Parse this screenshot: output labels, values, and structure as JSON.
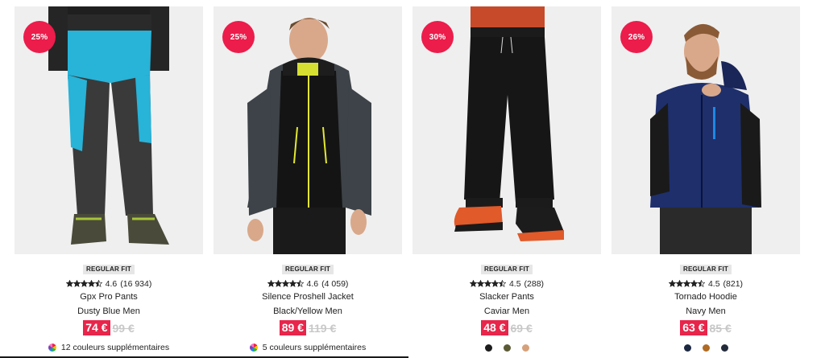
{
  "products": [
    {
      "discount": "25%",
      "fit": "REGULAR FIT",
      "rating": "4.6",
      "reviews": "(16 934)",
      "stars": 4.5,
      "name": "Gpx Pro Pants",
      "color": "Dusty Blue Men",
      "price": "74 €",
      "old_price": "99 €",
      "extra_colors": "12 couleurs supplémentaires",
      "image": "pants-blue-grey"
    },
    {
      "discount": "25%",
      "fit": "REGULAR FIT",
      "rating": "4.6",
      "reviews": "(4 059)",
      "stars": 4.5,
      "name": "Silence Proshell Jacket",
      "color": "Black/Yellow Men",
      "price": "89 €",
      "old_price": "119 €",
      "extra_colors": "5 couleurs supplémentaires",
      "image": "jacket-black-yellow"
    },
    {
      "discount": "30%",
      "fit": "REGULAR FIT",
      "rating": "4.5",
      "reviews": "(288)",
      "stars": 4.5,
      "name": "Slacker Pants",
      "color": "Caviar Men",
      "price": "48 €",
      "old_price": "69 €",
      "swatches": [
        "#1c1c1c",
        "#5a5a35",
        "#d6a17a"
      ],
      "image": "pants-black"
    },
    {
      "discount": "26%",
      "fit": "REGULAR FIT",
      "rating": "4.5",
      "reviews": "(821)",
      "stars": 4.5,
      "name": "Tornado Hoodie",
      "color": "Navy Men",
      "price": "63 €",
      "old_price": "85 €",
      "swatches": [
        "#1c2742",
        "#b06a22",
        "#232a3a"
      ],
      "image": "hoodie-navy"
    }
  ],
  "colors": {
    "badge": "#ec1c4b",
    "price_bg": "#e8254a",
    "image_bg": "#efefef"
  }
}
